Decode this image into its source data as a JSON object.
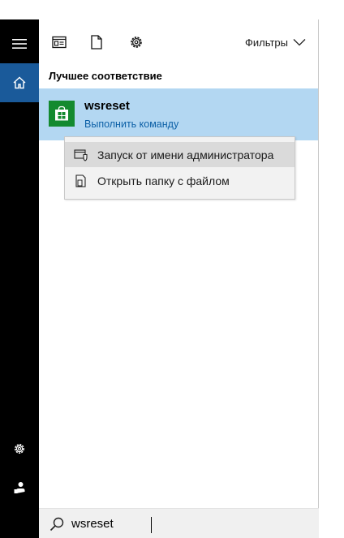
{
  "toolbar": {
    "filters_label": "Фильтры",
    "icons": [
      "apps-icon",
      "document-icon",
      "settings-icon"
    ]
  },
  "rail": {
    "icons": [
      "hamburger-menu-icon",
      "home-icon",
      "settings-icon",
      "user-icon"
    ]
  },
  "results": {
    "section_title": "Лучшее соответствие",
    "best_match": {
      "name": "wsreset",
      "subtitle": "Выполнить команду",
      "icon": "store-bag-icon"
    }
  },
  "context_menu": {
    "items": [
      {
        "label": "Запуск от имени администратора",
        "icon": "admin-shield-icon",
        "highlighted": true
      },
      {
        "label": "Открыть папку с файлом",
        "icon": "open-folder-icon",
        "highlighted": false
      }
    ]
  },
  "search": {
    "value": "wsreset",
    "icon": "search-icon"
  },
  "colors": {
    "rail": "#000000",
    "home_selected": "#1a5a9a",
    "best_match_bg": "#b3d7f2",
    "store_tile": "#138a2f",
    "link": "#0b5fa6"
  }
}
